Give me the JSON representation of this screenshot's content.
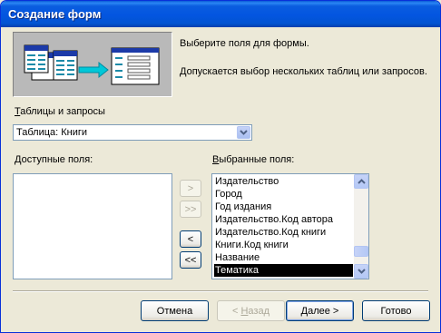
{
  "window": {
    "title": "Создание форм"
  },
  "header": {
    "line1": "Выберите поля для формы.",
    "line2": "Допускается выбор нескольких таблиц или запросов."
  },
  "source": {
    "label_first": "Т",
    "label_rest": "аблицы и запросы",
    "selected": "Таблица: Книги"
  },
  "available": {
    "label_first": "Д",
    "label_rest": "оступные поля:",
    "items": []
  },
  "selected": {
    "label_first": "В",
    "label_rest": "ыбранные поля:",
    "items": [
      "Издательство",
      "Город",
      "Год издания",
      "Издательство.Код автора",
      "Издательство.Код книги",
      "Книги.Код книги",
      "Название",
      "Тематика"
    ],
    "selected_index": 7
  },
  "move": {
    "add_one": ">",
    "add_all": ">>",
    "remove_one": "<",
    "remove_all": "<<"
  },
  "footer": {
    "cancel": "Отмена",
    "back_prefix": "< ",
    "back_first": "Н",
    "back_rest": "азад",
    "next_first": "Д",
    "next_rest": "алее >",
    "finish": "Готово"
  },
  "colors": {
    "titlebar": "#0a5ddf",
    "selection": "#000000",
    "arrow": "#00c8d8"
  }
}
